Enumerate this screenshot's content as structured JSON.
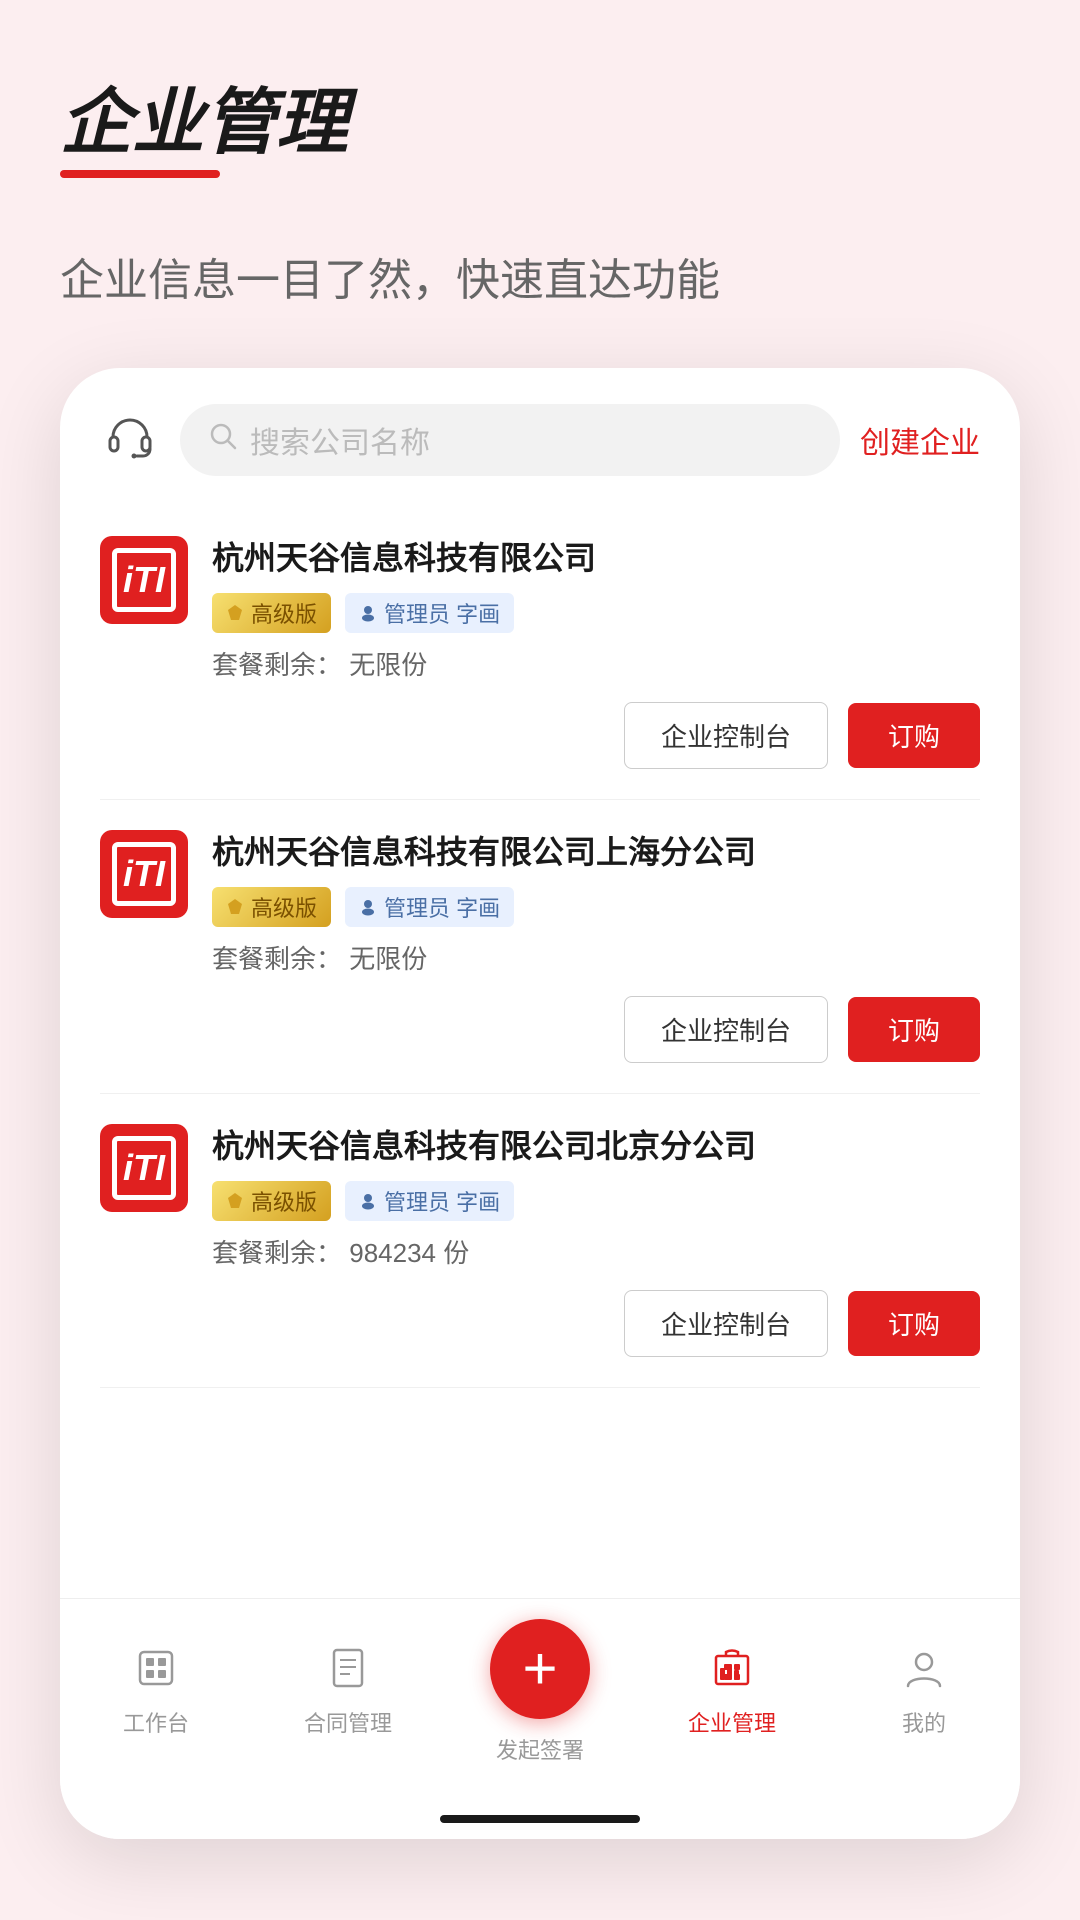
{
  "page": {
    "title": "企业管理",
    "title_underline_visible": true,
    "subtitle": "企业信息一目了然，快速直达功能"
  },
  "search": {
    "placeholder": "搜索公司名称",
    "create_btn": "创建企业"
  },
  "companies": [
    {
      "id": 1,
      "logo_text": "iTI",
      "name": "杭州天谷信息科技有限公司",
      "level": "高级版",
      "role": "管理员 字画",
      "quota_label": "套餐剩余：",
      "quota_value": "无限份",
      "console_btn": "企业控制台",
      "order_btn": "订购"
    },
    {
      "id": 2,
      "logo_text": "iTI",
      "name": "杭州天谷信息科技有限公司上海分公司",
      "level": "高级版",
      "role": "管理员 字画",
      "quota_label": "套餐剩余：",
      "quota_value": "无限份",
      "console_btn": "企业控制台",
      "order_btn": "订购"
    },
    {
      "id": 3,
      "logo_text": "iTI",
      "name": "杭州天谷信息科技有限公司北京分公司",
      "level": "高级版",
      "role": "管理员 字画",
      "quota_label": "套餐剩余：",
      "quota_value": "984234 份",
      "console_btn": "企业控制台",
      "order_btn": "订购"
    }
  ],
  "bottom_nav": {
    "items": [
      {
        "label": "工作台",
        "icon": "workbench",
        "active": false
      },
      {
        "label": "合同管理",
        "icon": "contract",
        "active": false
      },
      {
        "label": "发起签署",
        "icon": "plus",
        "active": false,
        "is_center": true
      },
      {
        "label": "企业管理",
        "icon": "enterprise",
        "active": true
      },
      {
        "label": "我的",
        "icon": "profile",
        "active": false
      }
    ]
  },
  "colors": {
    "brand_red": "#e02020",
    "bg_pink": "#fceef0",
    "premium_gold": "#d4a020",
    "manager_blue": "#4a6fa5"
  }
}
